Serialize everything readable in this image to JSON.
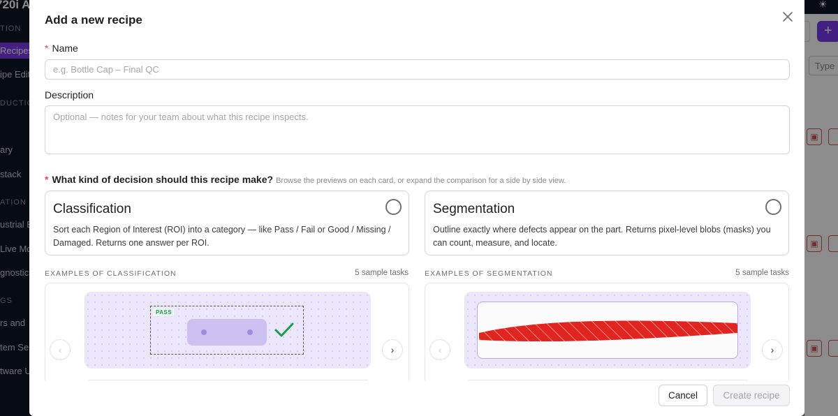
{
  "background": {
    "app_title_fragment": "720i A",
    "sidebar": [
      {
        "label": "TION",
        "kind": "section"
      },
      {
        "label": "Recipes",
        "kind": "active"
      },
      {
        "label": "ipe Edit",
        "kind": "item"
      },
      {
        "label": "DUCTIO",
        "kind": "section"
      },
      {
        "label": "ary",
        "kind": "item"
      },
      {
        "label": "stack",
        "kind": "item"
      },
      {
        "label": "ATION",
        "kind": "section"
      },
      {
        "label": "ustrial E",
        "kind": "item"
      },
      {
        "label": "Live Mo",
        "kind": "item"
      },
      {
        "label": "gnostic",
        "kind": "item"
      },
      {
        "label": "GS",
        "kind": "section"
      },
      {
        "label": "rs and",
        "kind": "item"
      },
      {
        "label": "tem Se",
        "kind": "item"
      },
      {
        "label": "tware U",
        "kind": "item"
      }
    ],
    "type_filter_placeholder": "Type",
    "add_button_label": "+",
    "theme_icon": "sun-icon",
    "row_action_icon": "image-icon",
    "accent_color": "#7c3aed"
  },
  "modal": {
    "title": "Add a new recipe",
    "close_icon": "close-icon",
    "name": {
      "label": "Name",
      "required_marker": "*",
      "value": "",
      "placeholder": "e.g. Bottle Cap – Final QC"
    },
    "description": {
      "label": "Description",
      "value": "",
      "placeholder": "Optional — notes for your team about what this recipe inspects."
    },
    "decision": {
      "required_marker": "*",
      "question": "What kind of decision should this recipe make?",
      "hint": "Browse the previews on each card, or expand the comparison for a side by side view."
    },
    "options": [
      {
        "title": "Classification",
        "description": "Sort each Region of Interest (ROI) into a category — like Pass / Fail or Good / Missing / Damaged. Returns one answer per ROI.",
        "selected": false,
        "examples_heading": "EXAMPLES OF CLASSIFICATION",
        "examples_count": "5 sample tasks",
        "preview_tag": "PASS",
        "prev_arrow": "‹",
        "next_arrow": "›"
      },
      {
        "title": "Segmentation",
        "description": "Outline exactly where defects appear on the part. Returns pixel-level blobs (masks) you can count, measure, and locate.",
        "selected": false,
        "examples_heading": "EXAMPLES OF SEGMENTATION",
        "examples_count": "5 sample tasks",
        "prev_arrow": "‹",
        "next_arrow": "›"
      }
    ],
    "footer": {
      "cancel_label": "Cancel",
      "create_label": "Create recipe",
      "create_enabled": false
    },
    "colors": {
      "required": "#e5484d",
      "pass_green": "#1a9c4a",
      "defect_red": "#e0241f",
      "preview_bg": "#ece6fa"
    }
  }
}
